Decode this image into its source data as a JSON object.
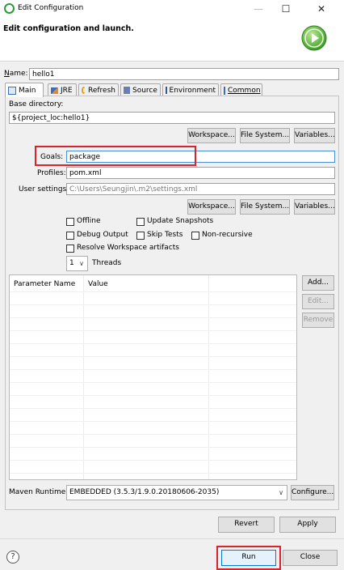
{
  "window": {
    "title": "Edit Configuration",
    "controls": {
      "minimize": "—",
      "maximize": "☐",
      "close": "✕"
    }
  },
  "header": {
    "title": "Edit configuration and launch."
  },
  "name": {
    "label_prefix": "N",
    "label_rest": "ame:",
    "value": "hello1"
  },
  "tabs": [
    {
      "label": "Main",
      "icon": "main-tab-icon",
      "active": true
    },
    {
      "label": "JRE",
      "icon": "jre-tab-icon"
    },
    {
      "label": "Refresh",
      "icon": "refresh-tab-icon"
    },
    {
      "label": "Source",
      "icon": "source-tab-icon"
    },
    {
      "label": "Environment",
      "icon": "environment-tab-icon"
    },
    {
      "label": "Common",
      "icon": "common-tab-icon"
    }
  ],
  "main": {
    "base_directory_label": "Base directory:",
    "base_directory_value": "${project_loc:hello1}",
    "workspace_btn": "Workspace...",
    "filesystem_btn": "File System...",
    "variables_btn": "Variables...",
    "goals_label": "Goals:",
    "goals_value": "package",
    "profiles_label": "Profiles:",
    "profiles_value": "pom.xml",
    "user_settings_label": "User settings:",
    "user_settings_value": "C:\\Users\\Seungjin\\.m2\\settings.xml",
    "offline_label": "Offline",
    "update_snapshots_label": "Update Snapshots",
    "debug_output_label": "Debug Output",
    "skip_tests_label": "Skip Tests",
    "non_recursive_label": "Non-recursive",
    "resolve_workspace_label": "Resolve Workspace artifacts",
    "threads_value": "1",
    "threads_label": "Threads",
    "table": {
      "col_parameter": "Parameter Name",
      "col_value": "Value"
    },
    "add_btn": "Add...",
    "edit_btn": "Edit...",
    "remove_btn": "Remove",
    "runtime_label": "Maven Runtime:",
    "runtime_value": "EMBEDDED (3.5.3/1.9.0.20180606-2035)",
    "configure_btn": "Configure..."
  },
  "revert_btn": "Revert",
  "apply_btn": "Apply",
  "run_btn": "Run",
  "close_btn": "Close",
  "help": "?"
}
